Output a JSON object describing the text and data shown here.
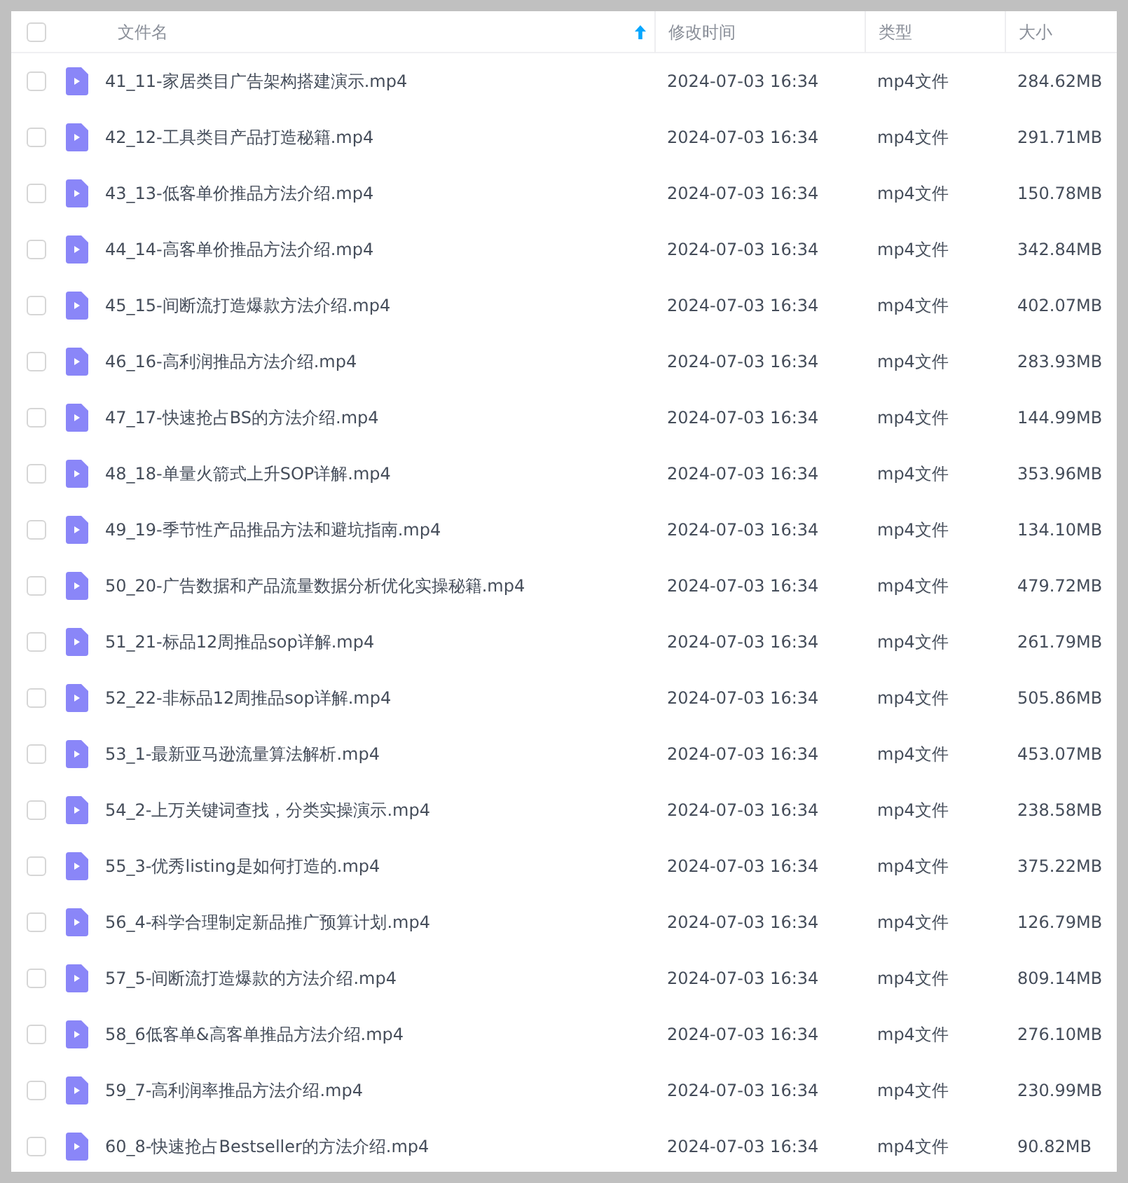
{
  "table": {
    "select_all": {
      "checked": false
    },
    "columns": [
      {
        "label": "文件名",
        "sorted": true
      },
      {
        "label": "修改时间",
        "sorted": false
      },
      {
        "label": "类型",
        "sorted": false
      },
      {
        "label": "大小",
        "sorted": false
      }
    ],
    "rows": [
      {
        "name": "41_11-家居类目广告架构搭建演示.mp4",
        "modified": "2024-07-03 16:34",
        "type": "mp4文件",
        "size": "284.62MB",
        "checked": false
      },
      {
        "name": "42_12-工具类目产品打造秘籍.mp4",
        "modified": "2024-07-03 16:34",
        "type": "mp4文件",
        "size": "291.71MB",
        "checked": false
      },
      {
        "name": "43_13-低客单价推品方法介绍.mp4",
        "modified": "2024-07-03 16:34",
        "type": "mp4文件",
        "size": "150.78MB",
        "checked": false
      },
      {
        "name": "44_14-高客单价推品方法介绍.mp4",
        "modified": "2024-07-03 16:34",
        "type": "mp4文件",
        "size": "342.84MB",
        "checked": false
      },
      {
        "name": "45_15-间断流打造爆款方法介绍.mp4",
        "modified": "2024-07-03 16:34",
        "type": "mp4文件",
        "size": "402.07MB",
        "checked": false
      },
      {
        "name": "46_16-高利润推品方法介绍.mp4",
        "modified": "2024-07-03 16:34",
        "type": "mp4文件",
        "size": "283.93MB",
        "checked": false
      },
      {
        "name": "47_17-快速抢占BS的方法介绍.mp4",
        "modified": "2024-07-03 16:34",
        "type": "mp4文件",
        "size": "144.99MB",
        "checked": false
      },
      {
        "name": "48_18-单量火箭式上升SOP详解.mp4",
        "modified": "2024-07-03 16:34",
        "type": "mp4文件",
        "size": "353.96MB",
        "checked": false
      },
      {
        "name": "49_19-季节性产品推品方法和避坑指南.mp4",
        "modified": "2024-07-03 16:34",
        "type": "mp4文件",
        "size": "134.10MB",
        "checked": false
      },
      {
        "name": "50_20-广告数据和产品流量数据分析优化实操秘籍.mp4",
        "modified": "2024-07-03 16:34",
        "type": "mp4文件",
        "size": "479.72MB",
        "checked": false
      },
      {
        "name": "51_21-标品12周推品sop详解.mp4",
        "modified": "2024-07-03 16:34",
        "type": "mp4文件",
        "size": "261.79MB",
        "checked": false
      },
      {
        "name": "52_22-非标品12周推品sop详解.mp4",
        "modified": "2024-07-03 16:34",
        "type": "mp4文件",
        "size": "505.86MB",
        "checked": false
      },
      {
        "name": "53_1-最新亚马逊流量算法解析.mp4",
        "modified": "2024-07-03 16:34",
        "type": "mp4文件",
        "size": "453.07MB",
        "checked": false
      },
      {
        "name": "54_2-上万关键词查找，分类实操演示.mp4",
        "modified": "2024-07-03 16:34",
        "type": "mp4文件",
        "size": "238.58MB",
        "checked": false
      },
      {
        "name": "55_3-优秀listing是如何打造的.mp4",
        "modified": "2024-07-03 16:34",
        "type": "mp4文件",
        "size": "375.22MB",
        "checked": false
      },
      {
        "name": "56_4-科学合理制定新品推广预算计划.mp4",
        "modified": "2024-07-03 16:34",
        "type": "mp4文件",
        "size": "126.79MB",
        "checked": false
      },
      {
        "name": "57_5-间断流打造爆款的方法介绍.mp4",
        "modified": "2024-07-03 16:34",
        "type": "mp4文件",
        "size": "809.14MB",
        "checked": false
      },
      {
        "name": "58_6低客单&高客单推品方法介绍.mp4",
        "modified": "2024-07-03 16:34",
        "type": "mp4文件",
        "size": "276.10MB",
        "checked": false
      },
      {
        "name": "59_7-高利润率推品方法介绍.mp4",
        "modified": "2024-07-03 16:34",
        "type": "mp4文件",
        "size": "230.99MB",
        "checked": false
      },
      {
        "name": "60_8-快速抢占Bestseller的方法介绍.mp4",
        "modified": "2024-07-03 16:34",
        "type": "mp4文件",
        "size": "90.82MB",
        "checked": false
      }
    ]
  }
}
